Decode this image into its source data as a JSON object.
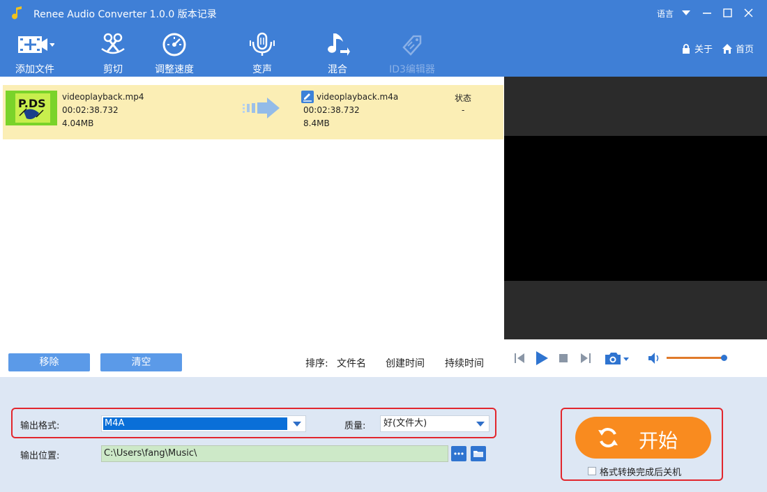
{
  "window": {
    "title": "Renee Audio Converter 1.0.0 版本记录",
    "language_label": "语言"
  },
  "toolbar": {
    "tools": [
      {
        "label": "添加文件",
        "icon": "add-file-icon"
      },
      {
        "label": "剪切",
        "icon": "scissors-icon"
      },
      {
        "label": "调整速度",
        "icon": "speed-icon"
      },
      {
        "label": "变声",
        "icon": "microphone-icon"
      },
      {
        "label": "混合",
        "icon": "music-note-icon"
      },
      {
        "label": "ID3编辑器",
        "icon": "tag-icon",
        "disabled": true
      }
    ],
    "about_label": "关于",
    "home_label": "首页"
  },
  "file_list": {
    "items": [
      {
        "source": {
          "name": "videoplayback.mp4",
          "duration": "00:02:38.732",
          "size": "4.04MB"
        },
        "output": {
          "name": "videoplayback.m4a",
          "duration": "00:02:38.732",
          "size": "8.4MB"
        },
        "status_header": "状态",
        "status": "-"
      }
    ],
    "remove_label": "移除",
    "clear_label": "清空",
    "sort_label": "排序:",
    "sort_options": [
      "文件名",
      "创建时间",
      "持续时间"
    ]
  },
  "settings": {
    "format_label": "输出格式:",
    "format_value": "M4A",
    "quality_label": "质量:",
    "quality_value": "好(文件大)",
    "location_label": "输出位置:",
    "location_value": "C:\\Users\\fang\\Music\\"
  },
  "start": {
    "label": "开始",
    "shutdown_label": "格式转换完成后关机"
  },
  "colors": {
    "titlebar": "#3f7fd6",
    "selected_row": "#fbeeb5",
    "start_button": "#f98b1f",
    "highlight_border": "#e2262d"
  }
}
